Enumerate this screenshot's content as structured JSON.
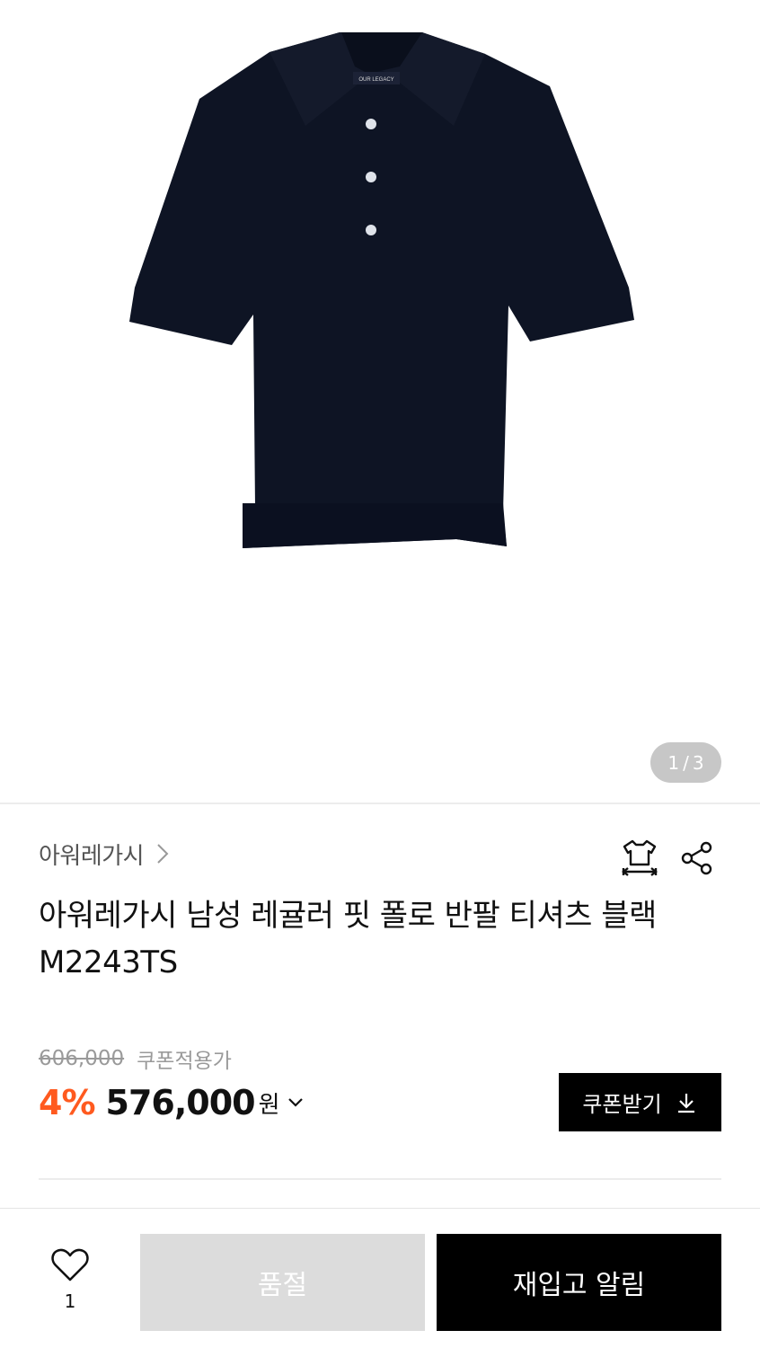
{
  "gallery": {
    "image_logo_text": "OUR LEGACY",
    "pager_current": "1",
    "pager_separator": "/",
    "pager_total": "3"
  },
  "product": {
    "brand": "아워레가시",
    "title_line1": "아워레가시 남성 레귤러 핏 폴로 반팔 티셔츠 블랙",
    "title_line2": "M2243TS"
  },
  "price": {
    "original": "606,000",
    "coupon_note": "쿠폰적용가",
    "discount": "4%",
    "final": "576,000",
    "currency": "원",
    "discount_color": "#ff5a1f"
  },
  "coupon_button": {
    "label": "쿠폰받기"
  },
  "bottom_bar": {
    "like_count": "1",
    "soldout_label": "품절",
    "restock_label": "재입고 알림"
  },
  "icons": {
    "brand_chevron": "chevron-right-icon",
    "size": "size-guide-icon",
    "share": "share-icon",
    "download": "download-icon",
    "price_chevron": "chevron-down-icon",
    "like": "heart-icon"
  }
}
